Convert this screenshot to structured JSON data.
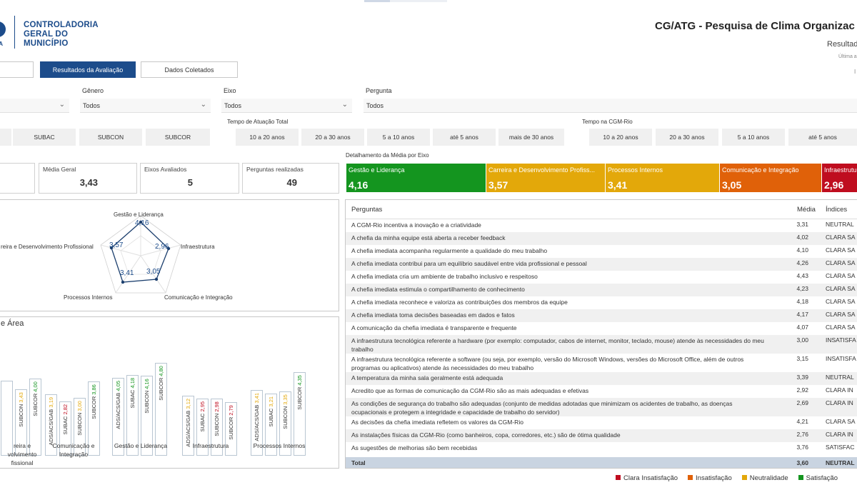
{
  "header": {
    "logo_small": "IA",
    "logo_lines": [
      "CONTROLADORIA",
      "GERAL DO",
      "MUNICÍPIO"
    ],
    "title": "CG/ATG  - Pesquisa de Clima Organizac",
    "subtitle": "Resultad",
    "subtitle2": "Última a",
    "dot": "I"
  },
  "nav": {
    "results": "Resultados da Avaliação",
    "collected": "Dados Coletados"
  },
  "filters": {
    "genero_label": "Gênero",
    "genero_value": "Todos",
    "eixo_label": "Eixo",
    "eixo_value": "Todos",
    "pergunta_label": "Pergunta",
    "pergunta_value": "Todos",
    "tempo_total_label": "Tempo de Atuação Total",
    "tempo_cgm_label": "Tempo na CGM-Rio"
  },
  "slicers": {
    "area": [
      "SUBAC",
      "SUBCON",
      "SUBCOR"
    ],
    "tempo_total": [
      "10 a 20 anos",
      "20 a 30 anos",
      "5 a 10 anos",
      "até 5 anos",
      "mais de 30 anos"
    ],
    "tempo_cgm": [
      "10 a 20 anos",
      "20 a 30 anos",
      "5 a 10 anos",
      "até 5 anos"
    ]
  },
  "cards": {
    "media_label": "Média Geral",
    "media_value": "3,43",
    "eixos_label": "Eixos Avaliados",
    "eixos_value": "5",
    "perguntas_label": "Perguntas realizadas",
    "perguntas_value": "49"
  },
  "axis_detail": {
    "label": "Detalhamento da Média por Eixo",
    "tiles": [
      {
        "name": "Gestão e Liderança",
        "value": "4,16",
        "color": "#14951f"
      },
      {
        "name": "Carreira e Desenvolvimento Profiss...",
        "value": "3,57",
        "color": "#e3a80a"
      },
      {
        "name": "Processos Internos",
        "value": "3,41",
        "color": "#e3a80a"
      },
      {
        "name": "Comunicação e Integração",
        "value": "3,05",
        "color": "#e06109"
      },
      {
        "name": "Infraestrutu",
        "value": "2,96",
        "color": "#bf0d1f"
      }
    ]
  },
  "radar": {
    "axes": [
      "Gestão e Liderança",
      "Infraestrutura",
      "Comunicação e Integração",
      "Processos Internos",
      "reira e Desenvolvimento Profissional"
    ],
    "values": [
      "4,16",
      "2,96",
      "3,05",
      "3,41",
      "3,57"
    ]
  },
  "area_chart": {
    "title": "e Área",
    "groups": [
      {
        "name": [
          "reira e",
          "volvimento",
          "fissional"
        ],
        "bars": [
          {
            "label": "",
            "value": "",
            "color": "#e3a80a"
          },
          {
            "label": "SUBCON",
            "value": "3,43",
            "color": "#e3a80a"
          },
          {
            "label": "SUBCOR",
            "value": "4,00",
            "color": "#14951f"
          }
        ]
      },
      {
        "name": [
          "Comunicação e",
          "Integração"
        ],
        "bars": [
          {
            "label": "ADS/ACS/GAB",
            "value": "3,19",
            "color": "#e3a80a"
          },
          {
            "label": "SUBAC",
            "value": "2,82",
            "color": "#bf0d1f"
          },
          {
            "label": "SUBCON",
            "value": "3,00",
            "color": "#e3a80a"
          },
          {
            "label": "SUBCOR",
            "value": "3,86",
            "color": "#14951f"
          }
        ]
      },
      {
        "name": [
          "Gestão e Liderança"
        ],
        "bars": [
          {
            "label": "ADS/ACS/GAB",
            "value": "4,05",
            "color": "#14951f"
          },
          {
            "label": "SUBAC",
            "value": "4,18",
            "color": "#14951f"
          },
          {
            "label": "SUBCON",
            "value": "4,16",
            "color": "#14951f"
          },
          {
            "label": "SUBCOR",
            "value": "4,80",
            "color": "#14951f"
          }
        ]
      },
      {
        "name": [
          "Infraestrutura"
        ],
        "bars": [
          {
            "label": "ADS/ACS/GAB",
            "value": "3,12",
            "color": "#e3a80a"
          },
          {
            "label": "SUBAC",
            "value": "2,95",
            "color": "#bf0d1f"
          },
          {
            "label": "SUBCON",
            "value": "2,98",
            "color": "#bf0d1f"
          },
          {
            "label": "SUBCOR",
            "value": "2,79",
            "color": "#bf0d1f"
          }
        ]
      },
      {
        "name": [
          "Processos Internos"
        ],
        "bars": [
          {
            "label": "ADS/ACS/GAB",
            "value": "3,41",
            "color": "#e3a80a"
          },
          {
            "label": "SUBAC",
            "value": "3,21",
            "color": "#e3a80a"
          },
          {
            "label": "SUBCON",
            "value": "3,35",
            "color": "#e3a80a"
          },
          {
            "label": "SUBCOR",
            "value": "4,35",
            "color": "#14951f"
          }
        ]
      }
    ]
  },
  "table": {
    "col_question": "Perguntas",
    "col_mean": "Média",
    "col_index": "Índices",
    "rows": [
      {
        "q": "A CGM-Rio incentiva a inovação e a criatividade",
        "m": "3,31",
        "i": "NEUTRAL"
      },
      {
        "q": "A chefia da minha equipe está aberta a receber feedback",
        "m": "4,02",
        "i": "CLARA SA"
      },
      {
        "q": "A chefia imediata acompanha regularmente a qualidade do meu trabalho",
        "m": "4,10",
        "i": "CLARA SA"
      },
      {
        "q": "A chefia imediata contribui para um equilíbrio saudável entre vida profissional e pessoal",
        "m": "4,26",
        "i": "CLARA SA"
      },
      {
        "q": "A chefia imediata cria um ambiente de trabalho inclusivo e respeitoso",
        "m": "4,43",
        "i": "CLARA SA"
      },
      {
        "q": "A chefia imediata estimula o compartilhamento de conhecimento",
        "m": "4,23",
        "i": "CLARA SA"
      },
      {
        "q": "A chefia imediata reconhece e valoriza as contribuições dos membros da equipe",
        "m": "4,18",
        "i": "CLARA SA"
      },
      {
        "q": "A chefia imediata toma decisões baseadas em dados e fatos",
        "m": "4,17",
        "i": "CLARA SA"
      },
      {
        "q": "A comunicação da chefia imediata é transparente e frequente",
        "m": "4,07",
        "i": "CLARA SA"
      },
      {
        "q": "A infraestrutura tecnológica referente a hardware (por exemplo: computador, cabos de internet, monitor, teclado, mouse) atende às necessidades do meu trabalho",
        "m": "3,00",
        "i": "INSATISFA"
      },
      {
        "q": "A infraestrutura tecnológica referente a software (ou seja, por exemplo, versão do Microsoft Windows, versões do Microsoft Office, além de outros programas ou aplicativos) atende às necessidades do meu trabalho",
        "m": "3,15",
        "i": "INSATISFA"
      },
      {
        "q": "A temperatura da minha sala geralmente está adequada",
        "m": "3,39",
        "i": "NEUTRAL"
      },
      {
        "q": "Acredito que as formas de comunicação da CGM-Rio são as mais adequadas e efetivas",
        "m": "2,92",
        "i": "CLARA IN"
      },
      {
        "q": "As condições de segurança do trabalho são adequadas (conjunto de medidas adotadas que minimizam os acidentes de trabalho, as doenças ocupacionais e protegem a integridade e capacidade de trabalho do servidor)",
        "m": "2,69",
        "i": "CLARA IN"
      },
      {
        "q": "As decisões da chefia imediata refletem os valores da CGM-Rio",
        "m": "4,21",
        "i": "CLARA SA"
      },
      {
        "q": "As instalações físicas da CGM-Rio (como banheiros, copa, corredores, etc.) são de ótima qualidade",
        "m": "2,76",
        "i": "CLARA IN"
      },
      {
        "q": "As sugestões de melhorias são bem recebidas",
        "m": "3,76",
        "i": "SATISFAC"
      }
    ],
    "total_label": "Total",
    "total_mean": "3,60",
    "total_index": "NEUTRAL"
  },
  "legend": [
    {
      "label": "Clara Insatisfação",
      "color": "#bf0d1f"
    },
    {
      "label": "Insatisfação",
      "color": "#e06109"
    },
    {
      "label": "Neutralidade",
      "color": "#e3a80a"
    },
    {
      "label": "Satisfação",
      "color": "#14951f"
    }
  ]
}
